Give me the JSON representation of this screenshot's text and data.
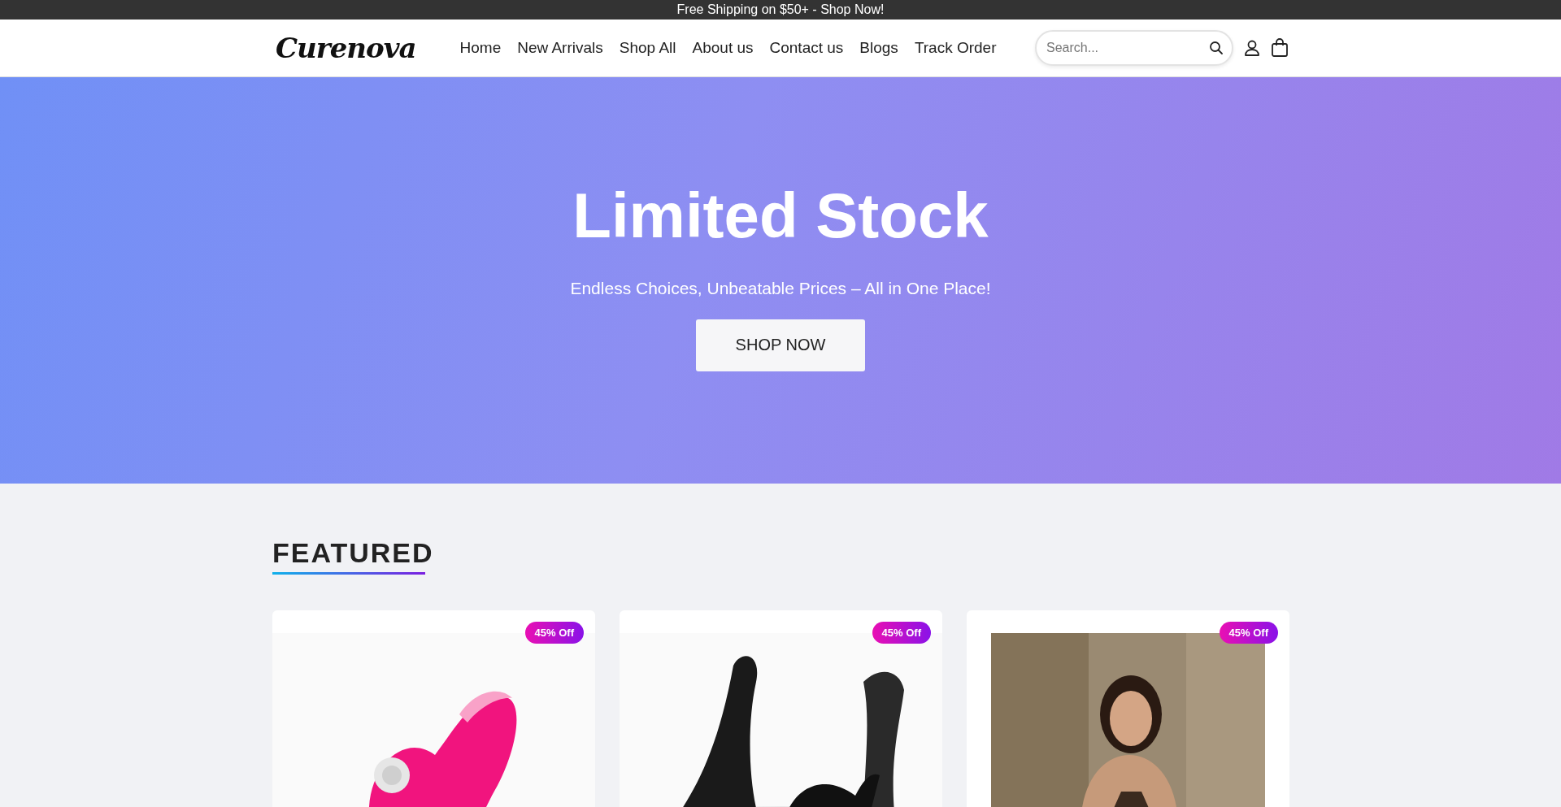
{
  "announcement": "Free Shipping on $50+ - Shop Now!",
  "header": {
    "logo": "Curenova",
    "nav": [
      {
        "label": "Home"
      },
      {
        "label": "New Arrivals"
      },
      {
        "label": "Shop All"
      },
      {
        "label": "About us"
      },
      {
        "label": "Contact us"
      },
      {
        "label": "Blogs"
      },
      {
        "label": "Track Order"
      }
    ],
    "search": {
      "placeholder": "Search..."
    }
  },
  "hero": {
    "title": "Limited Stock",
    "subtitle": "Endless Choices, Unbeatable Prices – All in One Place!",
    "button": "SHOP NOW"
  },
  "featured": {
    "title": "FEATURED",
    "products": [
      {
        "badge": "45% Off",
        "kind": "pink"
      },
      {
        "badge": "45% Off",
        "kind": "dark"
      },
      {
        "badge": "45% Off"
      }
    ]
  }
}
